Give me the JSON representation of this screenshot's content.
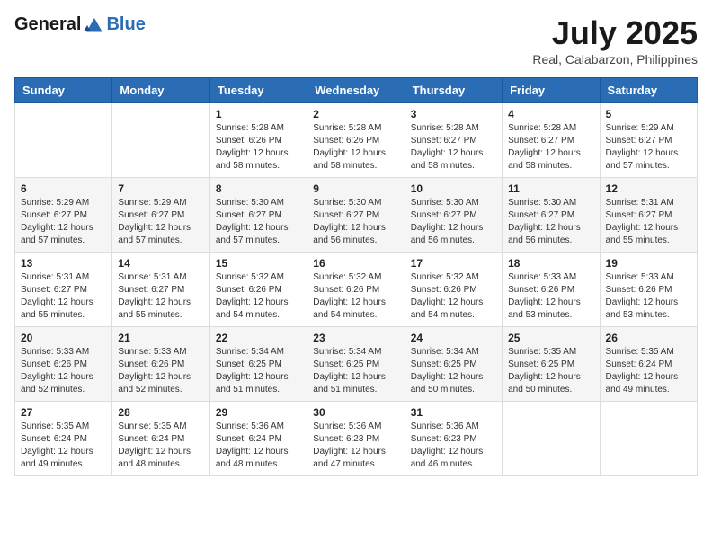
{
  "header": {
    "logo_general": "General",
    "logo_blue": "Blue",
    "month_title": "July 2025",
    "location": "Real, Calabarzon, Philippines"
  },
  "weekdays": [
    "Sunday",
    "Monday",
    "Tuesday",
    "Wednesday",
    "Thursday",
    "Friday",
    "Saturday"
  ],
  "weeks": [
    [
      {
        "day": "",
        "info": ""
      },
      {
        "day": "",
        "info": ""
      },
      {
        "day": "1",
        "info": "Sunrise: 5:28 AM\nSunset: 6:26 PM\nDaylight: 12 hours and 58 minutes."
      },
      {
        "day": "2",
        "info": "Sunrise: 5:28 AM\nSunset: 6:26 PM\nDaylight: 12 hours and 58 minutes."
      },
      {
        "day": "3",
        "info": "Sunrise: 5:28 AM\nSunset: 6:27 PM\nDaylight: 12 hours and 58 minutes."
      },
      {
        "day": "4",
        "info": "Sunrise: 5:28 AM\nSunset: 6:27 PM\nDaylight: 12 hours and 58 minutes."
      },
      {
        "day": "5",
        "info": "Sunrise: 5:29 AM\nSunset: 6:27 PM\nDaylight: 12 hours and 57 minutes."
      }
    ],
    [
      {
        "day": "6",
        "info": "Sunrise: 5:29 AM\nSunset: 6:27 PM\nDaylight: 12 hours and 57 minutes."
      },
      {
        "day": "7",
        "info": "Sunrise: 5:29 AM\nSunset: 6:27 PM\nDaylight: 12 hours and 57 minutes."
      },
      {
        "day": "8",
        "info": "Sunrise: 5:30 AM\nSunset: 6:27 PM\nDaylight: 12 hours and 57 minutes."
      },
      {
        "day": "9",
        "info": "Sunrise: 5:30 AM\nSunset: 6:27 PM\nDaylight: 12 hours and 56 minutes."
      },
      {
        "day": "10",
        "info": "Sunrise: 5:30 AM\nSunset: 6:27 PM\nDaylight: 12 hours and 56 minutes."
      },
      {
        "day": "11",
        "info": "Sunrise: 5:30 AM\nSunset: 6:27 PM\nDaylight: 12 hours and 56 minutes."
      },
      {
        "day": "12",
        "info": "Sunrise: 5:31 AM\nSunset: 6:27 PM\nDaylight: 12 hours and 55 minutes."
      }
    ],
    [
      {
        "day": "13",
        "info": "Sunrise: 5:31 AM\nSunset: 6:27 PM\nDaylight: 12 hours and 55 minutes."
      },
      {
        "day": "14",
        "info": "Sunrise: 5:31 AM\nSunset: 6:27 PM\nDaylight: 12 hours and 55 minutes."
      },
      {
        "day": "15",
        "info": "Sunrise: 5:32 AM\nSunset: 6:26 PM\nDaylight: 12 hours and 54 minutes."
      },
      {
        "day": "16",
        "info": "Sunrise: 5:32 AM\nSunset: 6:26 PM\nDaylight: 12 hours and 54 minutes."
      },
      {
        "day": "17",
        "info": "Sunrise: 5:32 AM\nSunset: 6:26 PM\nDaylight: 12 hours and 54 minutes."
      },
      {
        "day": "18",
        "info": "Sunrise: 5:33 AM\nSunset: 6:26 PM\nDaylight: 12 hours and 53 minutes."
      },
      {
        "day": "19",
        "info": "Sunrise: 5:33 AM\nSunset: 6:26 PM\nDaylight: 12 hours and 53 minutes."
      }
    ],
    [
      {
        "day": "20",
        "info": "Sunrise: 5:33 AM\nSunset: 6:26 PM\nDaylight: 12 hours and 52 minutes."
      },
      {
        "day": "21",
        "info": "Sunrise: 5:33 AM\nSunset: 6:26 PM\nDaylight: 12 hours and 52 minutes."
      },
      {
        "day": "22",
        "info": "Sunrise: 5:34 AM\nSunset: 6:25 PM\nDaylight: 12 hours and 51 minutes."
      },
      {
        "day": "23",
        "info": "Sunrise: 5:34 AM\nSunset: 6:25 PM\nDaylight: 12 hours and 51 minutes."
      },
      {
        "day": "24",
        "info": "Sunrise: 5:34 AM\nSunset: 6:25 PM\nDaylight: 12 hours and 50 minutes."
      },
      {
        "day": "25",
        "info": "Sunrise: 5:35 AM\nSunset: 6:25 PM\nDaylight: 12 hours and 50 minutes."
      },
      {
        "day": "26",
        "info": "Sunrise: 5:35 AM\nSunset: 6:24 PM\nDaylight: 12 hours and 49 minutes."
      }
    ],
    [
      {
        "day": "27",
        "info": "Sunrise: 5:35 AM\nSunset: 6:24 PM\nDaylight: 12 hours and 49 minutes."
      },
      {
        "day": "28",
        "info": "Sunrise: 5:35 AM\nSunset: 6:24 PM\nDaylight: 12 hours and 48 minutes."
      },
      {
        "day": "29",
        "info": "Sunrise: 5:36 AM\nSunset: 6:24 PM\nDaylight: 12 hours and 48 minutes."
      },
      {
        "day": "30",
        "info": "Sunrise: 5:36 AM\nSunset: 6:23 PM\nDaylight: 12 hours and 47 minutes."
      },
      {
        "day": "31",
        "info": "Sunrise: 5:36 AM\nSunset: 6:23 PM\nDaylight: 12 hours and 46 minutes."
      },
      {
        "day": "",
        "info": ""
      },
      {
        "day": "",
        "info": ""
      }
    ]
  ]
}
